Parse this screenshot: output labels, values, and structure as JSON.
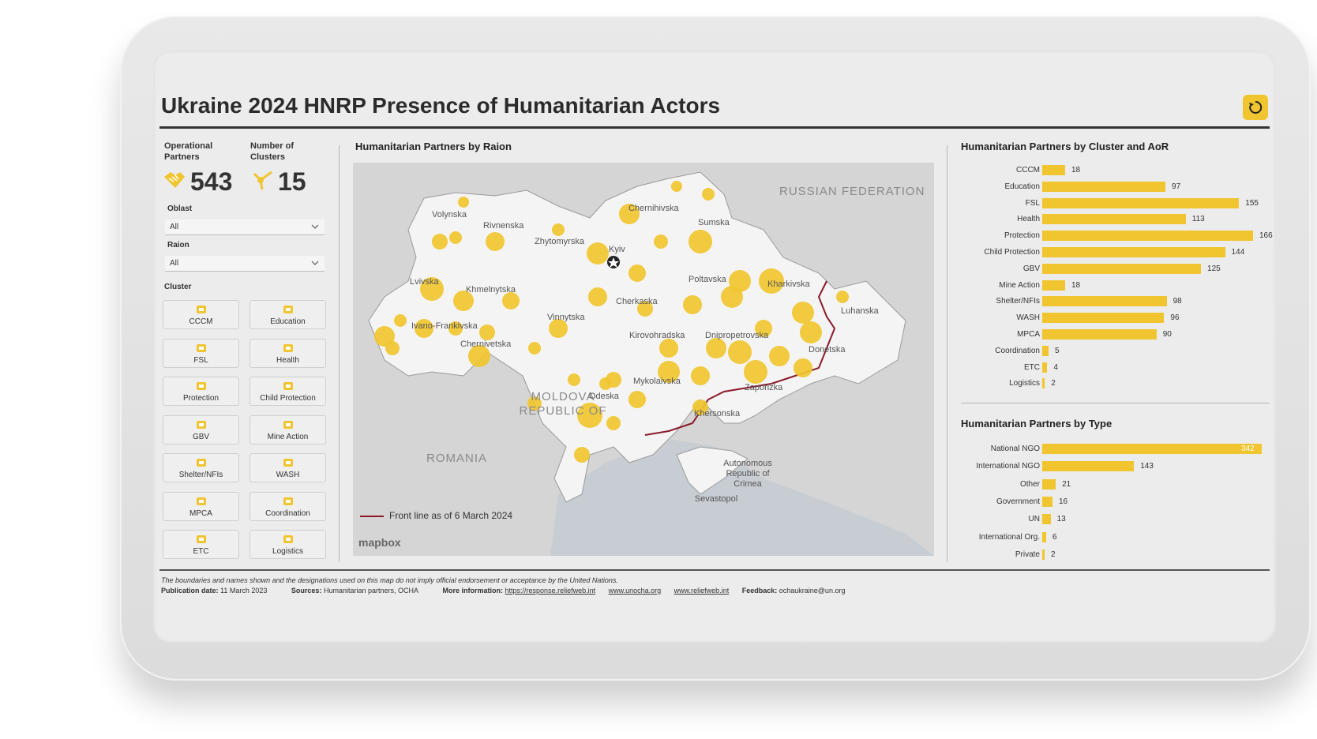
{
  "title": "Ukraine 2024 HNRP Presence of Humanitarian Actors",
  "kpis": {
    "operational_label": "Operational Partners",
    "operational_value": "543",
    "clusters_label": "Number of Clusters",
    "clusters_value": "15"
  },
  "filters": {
    "oblast_label": "Oblast",
    "oblast_value": "All",
    "raion_label": "Raion",
    "raion_value": "All",
    "cluster_label": "Cluster"
  },
  "clusters": [
    {
      "label": "CCCM",
      "icon": "camp-icon"
    },
    {
      "label": "Education",
      "icon": "book-icon"
    },
    {
      "label": "FSL",
      "icon": "food-icon"
    },
    {
      "label": "Health",
      "icon": "health-icon"
    },
    {
      "label": "Protection",
      "icon": "protection-icon"
    },
    {
      "label": "Child Protection",
      "icon": "child-protection-icon"
    },
    {
      "label": "GBV",
      "icon": "gbv-icon"
    },
    {
      "label": "Mine Action",
      "icon": "mine-icon"
    },
    {
      "label": "Shelter/NFIs",
      "icon": "shelter-icon"
    },
    {
      "label": "WASH",
      "icon": "water-icon"
    },
    {
      "label": "MPCA",
      "icon": "cash-icon"
    },
    {
      "label": "Coordination",
      "icon": "coordination-icon"
    },
    {
      "label": "ETC",
      "icon": "antenna-icon"
    },
    {
      "label": "Logistics",
      "icon": "logistics-icon"
    }
  ],
  "map": {
    "title": "Humanitarian Partners by Raion",
    "legend": "Front line as of 6 March 2024",
    "attribution": "mapbox",
    "countries": [
      "RUSSIAN FEDERATION",
      "MOLDOVA REPUBLIC OF",
      "ROMANIA"
    ],
    "regions": [
      "Volynska",
      "Rivnenska",
      "Zhytomyrska",
      "Chernihivska",
      "Sumska",
      "Kyiv",
      "Lvivska",
      "Khmelnytska",
      "Poltavska",
      "Kharkivska",
      "Luhanska",
      "Ivano-Frankivska",
      "Vinnytska",
      "Cherkaska",
      "Kirovohradska",
      "Dnipropetrovska",
      "Chernivetska",
      "Donetska",
      "Mykolaivska",
      "Odeska",
      "Zaporizka",
      "Khersonska",
      "Autonomous Republic of Crimea",
      "Sevastopol"
    ]
  },
  "cluster_chart": {
    "title": "Humanitarian Partners by Cluster and AoR",
    "type": "bar",
    "categories": [
      "CCCM",
      "Education",
      "FSL",
      "Health",
      "Protection",
      "Child Protection",
      "GBV",
      "Mine Action",
      "Shelter/NFIs",
      "WASH",
      "MPCA",
      "Coordination",
      "ETC",
      "Logistics"
    ],
    "values": [
      18,
      97,
      155,
      113,
      166,
      144,
      125,
      18,
      98,
      96,
      90,
      5,
      4,
      2
    ]
  },
  "type_chart": {
    "title": "Humanitarian Partners by Type",
    "type": "bar",
    "categories": [
      "National NGO",
      "International NGO",
      "Other",
      "Government",
      "UN",
      "International Org.",
      "Private"
    ],
    "values": [
      342,
      143,
      21,
      16,
      13,
      6,
      2
    ]
  },
  "chart_data": [
    {
      "type": "bar",
      "title": "Humanitarian Partners by Cluster and AoR",
      "categories": [
        "CCCM",
        "Education",
        "FSL",
        "Health",
        "Protection",
        "Child Protection",
        "GBV",
        "Mine Action",
        "Shelter/NFIs",
        "WASH",
        "MPCA",
        "Coordination",
        "ETC",
        "Logistics"
      ],
      "values": [
        18,
        97,
        155,
        113,
        166,
        144,
        125,
        18,
        98,
        96,
        90,
        5,
        4,
        2
      ]
    },
    {
      "type": "bar",
      "title": "Humanitarian Partners by Type",
      "categories": [
        "National NGO",
        "International NGO",
        "Other",
        "Government",
        "UN",
        "International Org.",
        "Private"
      ],
      "values": [
        342,
        143,
        21,
        16,
        13,
        6,
        2
      ]
    }
  ],
  "footer": {
    "disclaimer": "The boundaries and names shown and the designations used on this map do not imply official endorsement or acceptance by the United Nations.",
    "pub_label": "Publication date:",
    "pub_value": "11 March 2023",
    "sources_label": "Sources:",
    "sources_value": "Humanitarian partners, OCHA",
    "more_label": "More information:",
    "link1": "https://response.reliefweb.int",
    "link2": "www.unocha.org",
    "link3": "www.reliefweb.int",
    "feedback_label": "Feedback:",
    "feedback_value": "ochaukraine@un.org"
  },
  "colors": {
    "accent": "#f0c530",
    "frontline": "#8b1a2b"
  }
}
